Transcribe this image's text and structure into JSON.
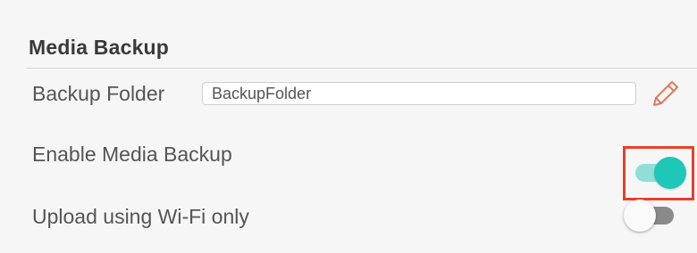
{
  "section": {
    "title": "Media Backup"
  },
  "backup_folder": {
    "label": "Backup Folder",
    "value": "BackupFolder",
    "edit_icon": "pencil-icon"
  },
  "enable_backup": {
    "label": "Enable Media Backup",
    "state": "on",
    "highlighted": true
  },
  "wifi_only": {
    "label": "Upload using Wi-Fi only",
    "state": "off"
  },
  "colors": {
    "toggle_on_knob": "#1ec7b7",
    "toggle_on_track": "#8fdfd7",
    "toggle_off_track": "#8a8a8a",
    "highlight_border": "#e8402a"
  }
}
